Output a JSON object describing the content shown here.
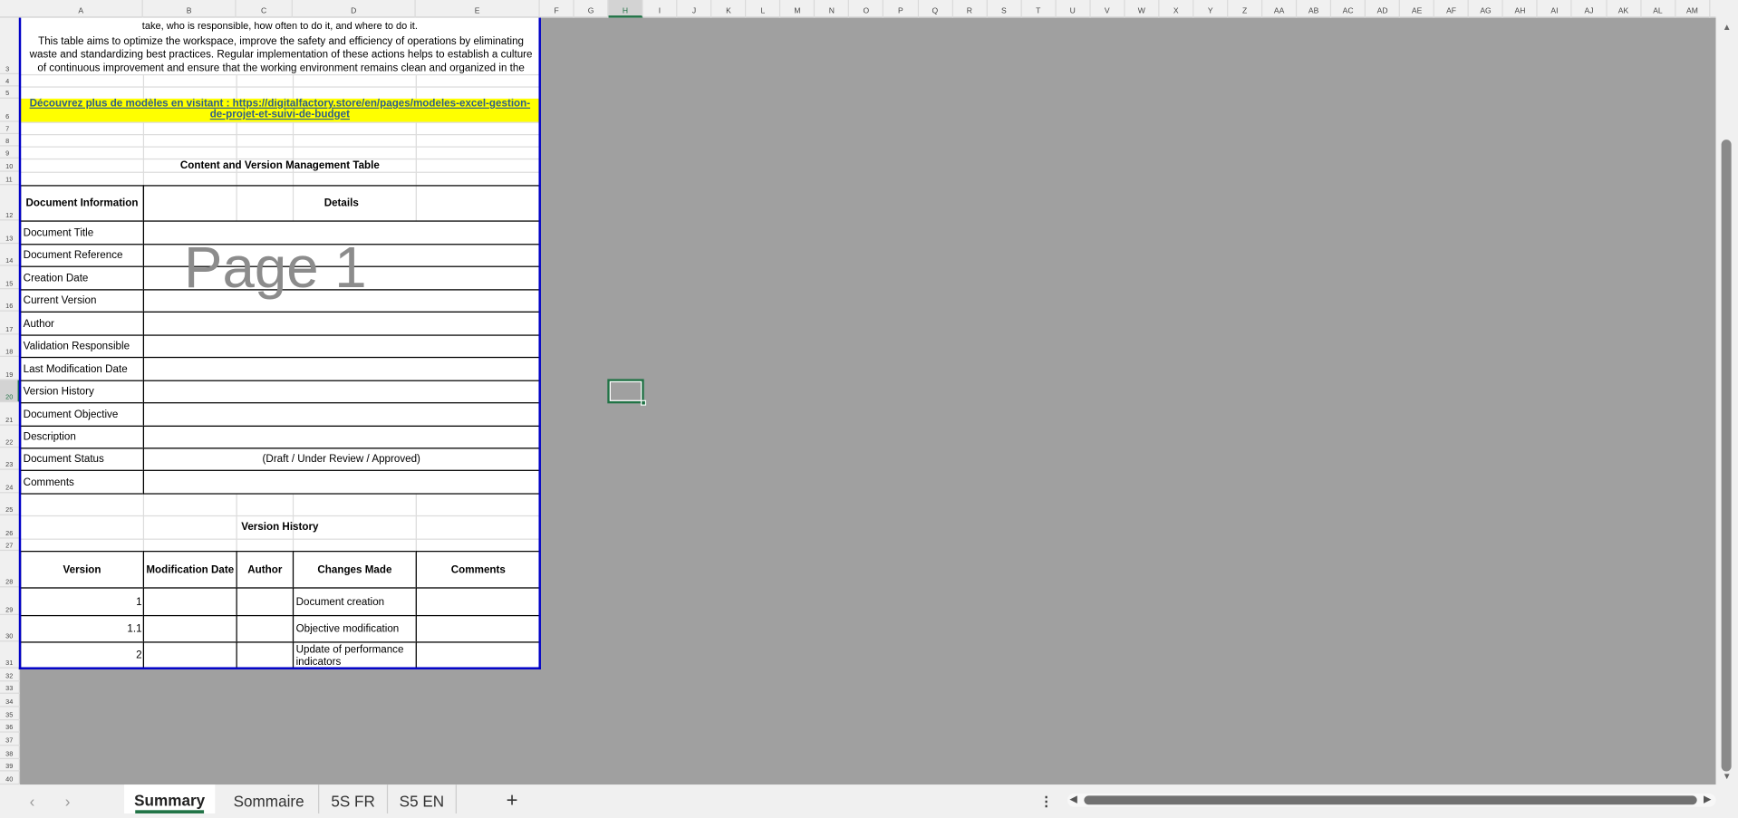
{
  "columns": [
    "A",
    "B",
    "C",
    "D",
    "E",
    "F",
    "G",
    "H",
    "I",
    "J",
    "K",
    "L",
    "M",
    "N",
    "O",
    "P",
    "Q",
    "R",
    "S",
    "T",
    "U",
    "V",
    "W",
    "X",
    "Y",
    "Z",
    "AA",
    "AB",
    "AC",
    "AD",
    "AE",
    "AF",
    "AG",
    "AH",
    "AI",
    "AJ",
    "AK",
    "AL",
    "AM"
  ],
  "selected_column": "H",
  "row_headers": [
    "3",
    "4",
    "5",
    "6",
    "7",
    "8",
    "9",
    "10",
    "11",
    "12",
    "13",
    "14",
    "15",
    "16",
    "17",
    "18",
    "19",
    "20",
    "21",
    "22",
    "23",
    "24",
    "25",
    "26",
    "27",
    "28",
    "29",
    "30",
    "31",
    "32",
    "33",
    "34",
    "35",
    "36",
    "37",
    "38",
    "39",
    "40"
  ],
  "selected_row": "20",
  "selected_cell": "H20",
  "intro": {
    "cut_line": "take, who is responsible, how often to do it, and where to do it.",
    "paragraph": "This table aims to optimize the workspace, improve the safety and efficiency of operations by eliminating waste and standardizing best practices. Regular implementation of these actions helps to establish a culture of continuous improvement and ensure that the working environment remains clean and organized in the"
  },
  "link": {
    "text": "Découvrez plus de modèles en visitant : https://digitalfactory.store/en/pages/modeles-excel-gestion-de-projet-et-suivi-de-budget",
    "highlight": "#ffff00",
    "color": "#2e5f8a"
  },
  "watermark": "Page 1",
  "content_table": {
    "title": "Content and Version Management Table",
    "headers": [
      "Document Information",
      "Details"
    ],
    "rows": [
      {
        "label": "Document Title",
        "value": ""
      },
      {
        "label": "Document Reference",
        "value": ""
      },
      {
        "label": "Creation Date",
        "value": ""
      },
      {
        "label": "Current Version",
        "value": ""
      },
      {
        "label": "Author",
        "value": ""
      },
      {
        "label": "Validation Responsible",
        "value": ""
      },
      {
        "label": "Last Modification Date",
        "value": ""
      },
      {
        "label": "Version History",
        "value": ""
      },
      {
        "label": "Document Objective",
        "value": ""
      },
      {
        "label": "Description",
        "value": ""
      },
      {
        "label": "Document Status",
        "value": "(Draft / Under Review / Approved)"
      },
      {
        "label": "Comments",
        "value": ""
      }
    ]
  },
  "version_table": {
    "title": "Version History",
    "headers": [
      "Version",
      "Modification Date",
      "Author",
      "Changes Made",
      "Comments"
    ],
    "rows": [
      [
        "1",
        "",
        "",
        "Document creation",
        ""
      ],
      [
        "1.1",
        "",
        "",
        "Objective modification",
        ""
      ],
      [
        "2",
        "",
        "",
        "Update of performance indicators",
        ""
      ]
    ]
  },
  "sheet_tabs": [
    {
      "label": "Summary",
      "active": true
    },
    {
      "label": "Sommaire",
      "active": false
    },
    {
      "label": "5S FR",
      "active": false
    },
    {
      "label": "S5 EN",
      "active": false
    }
  ],
  "colors": {
    "accent": "#217346",
    "print_border": "#0000c8",
    "outside_area": "#a0a0a0"
  }
}
